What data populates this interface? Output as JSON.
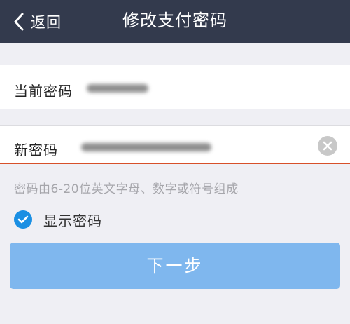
{
  "header": {
    "back_label": "返回",
    "title": "修改支付密码"
  },
  "form": {
    "current_password": {
      "label": "当前密码"
    },
    "new_password": {
      "label": "新密码"
    },
    "hint": "密码由6-20位英文字母、数字或符号组成",
    "show_password": {
      "label": "显示密码",
      "checked": true
    },
    "next_button_label": "下一步"
  },
  "colors": {
    "topbar": "#333a4d",
    "accent": "#1a8fe3",
    "button": "#7fb7ee",
    "input_underline": "#d7502a"
  }
}
